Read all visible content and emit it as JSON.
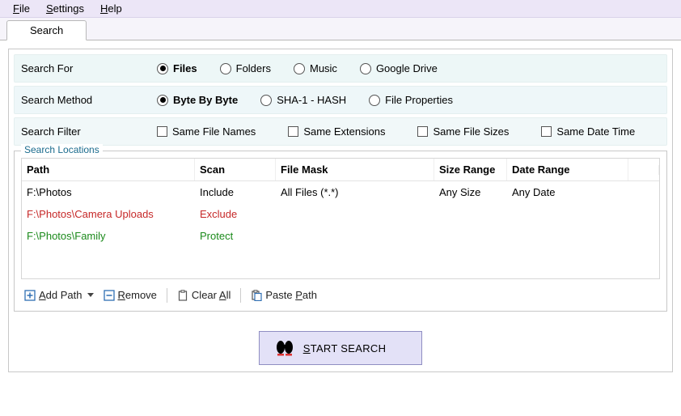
{
  "menubar": {
    "file": "File",
    "settings": "Settings",
    "help": "Help"
  },
  "tab": {
    "search": "Search"
  },
  "options": {
    "search_for": {
      "label": "Search For",
      "choices": [
        "Files",
        "Folders",
        "Music",
        "Google Drive"
      ],
      "selected": "Files"
    },
    "search_method": {
      "label": "Search Method",
      "choices": [
        "Byte By Byte",
        "SHA-1 - HASH",
        "File Properties"
      ],
      "selected": "Byte By Byte"
    },
    "search_filter": {
      "label": "Search Filter",
      "choices": [
        "Same File Names",
        "Same Extensions",
        "Same File Sizes",
        "Same Date Time"
      ]
    }
  },
  "locations": {
    "legend": "Search Locations",
    "columns": [
      "Path",
      "Scan",
      "File Mask",
      "Size Range",
      "Date Range"
    ],
    "rows": [
      {
        "path": "F:\\Photos",
        "scan": "Include",
        "mask": "All Files (*.*)",
        "size": "Any Size",
        "date": "Any Date",
        "style": "normal"
      },
      {
        "path": "F:\\Photos\\Camera Uploads",
        "scan": "Exclude",
        "mask": "",
        "size": "",
        "date": "",
        "style": "exclude"
      },
      {
        "path": "F:\\Photos\\Family",
        "scan": "Protect",
        "mask": "",
        "size": "",
        "date": "",
        "style": "protect"
      }
    ]
  },
  "toolbar": {
    "add_path": "Add Path",
    "remove": "Remove",
    "clear_all": "Clear All",
    "paste_path": "Paste Path"
  },
  "start": {
    "label": "START SEARCH"
  }
}
